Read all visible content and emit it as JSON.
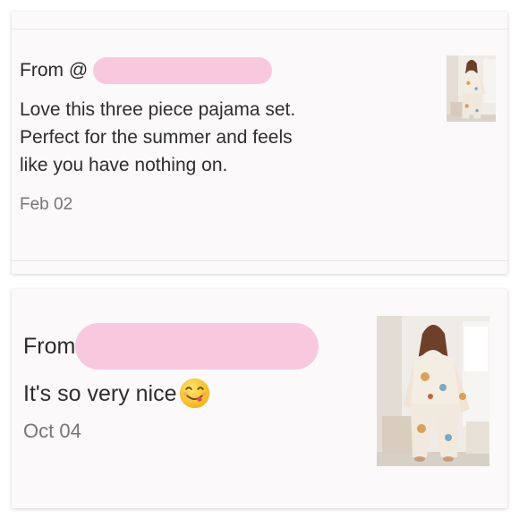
{
  "reviews": [
    {
      "from_label": "From @",
      "message_lines": [
        "Love this three piece pajama set.",
        "Perfect for the summer and feels",
        "like you have nothing on."
      ],
      "date": "Feb 02",
      "thumbnail_icon": "product-photo-pajama-set"
    },
    {
      "from_label": "From",
      "message": "It's so very nice",
      "emoji_icon": "face-savoring-food-emoji",
      "date": "Oct 04",
      "thumbnail_icon": "product-photo-pajama-set"
    }
  ],
  "colors": {
    "card_bg": "#fbf9fa",
    "redaction": "#f8c8df",
    "text": "#2e2e2e",
    "date": "#767676"
  }
}
